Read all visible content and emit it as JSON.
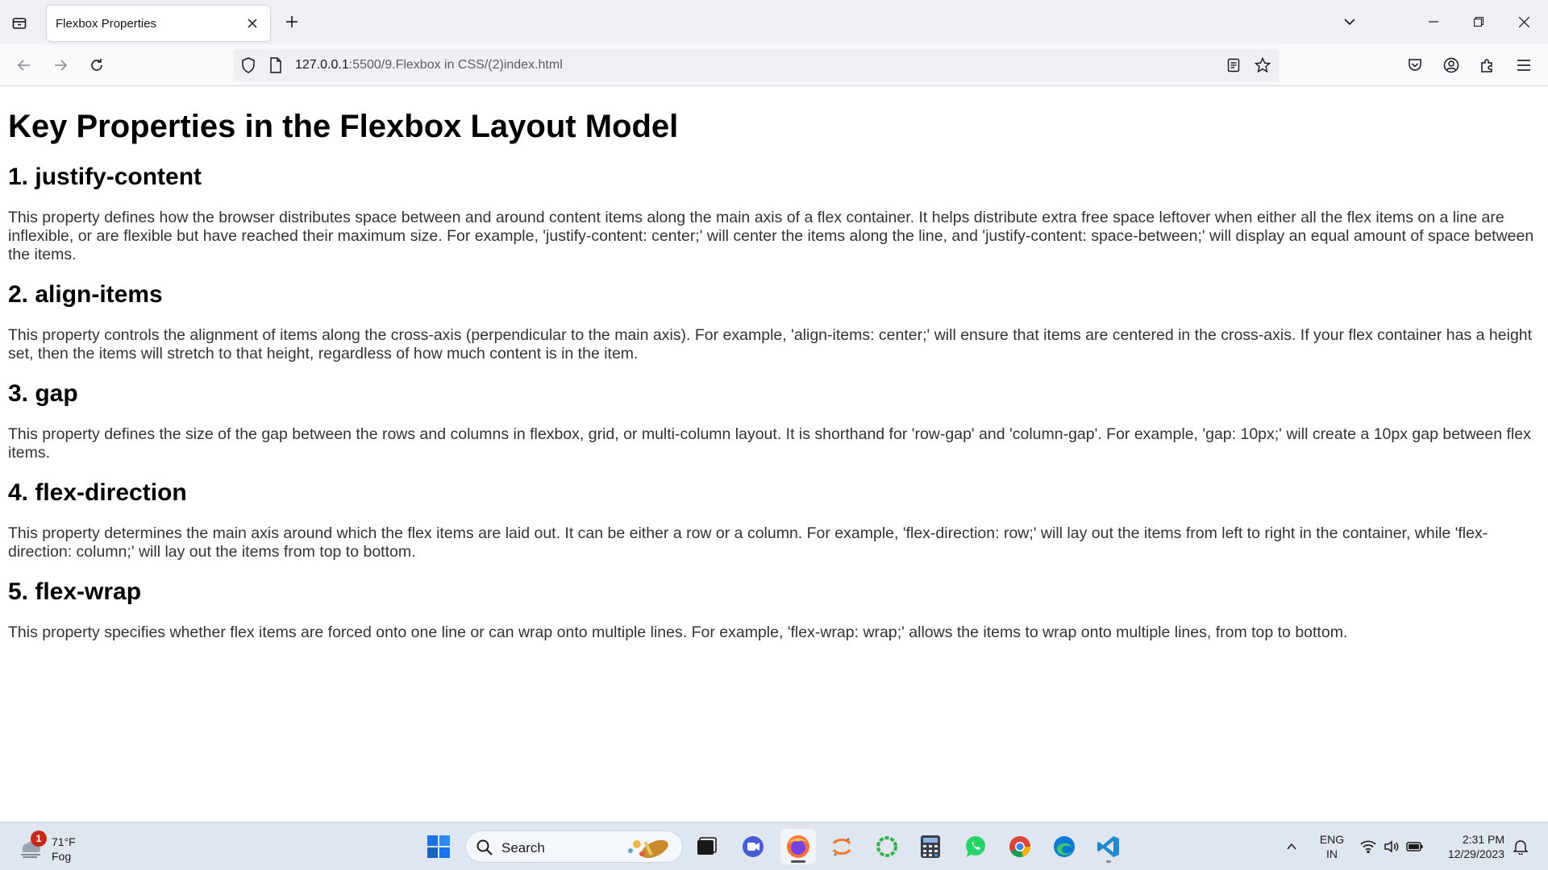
{
  "browser": {
    "tab_title": "Flexbox Properties",
    "url_host": "127.0.0.1",
    "url_rest": ":5500/9.Flexbox in CSS/(2)index.html"
  },
  "page": {
    "heading": "Key Properties in the Flexbox Layout Model",
    "sections": [
      {
        "title": "1. justify-content",
        "body": "This property defines how the browser distributes space between and around content items along the main axis of a flex container. It helps distribute extra free space leftover when either all the flex items on a line are inflexible, or are flexible but have reached their maximum size. For example, 'justify-content: center;' will center the items along the line, and 'justify-content: space-between;' will display an equal amount of space between the items."
      },
      {
        "title": "2. align-items",
        "body": "This property controls the alignment of items along the cross-axis (perpendicular to the main axis). For example, 'align-items: center;' will ensure that items are centered in the cross-axis. If your flex container has a height set, then the items will stretch to that height, regardless of how much content is in the item."
      },
      {
        "title": "3. gap",
        "body": "This property defines the size of the gap between the rows and columns in flexbox, grid, or multi-column layout. It is shorthand for 'row-gap' and 'column-gap'. For example, 'gap: 10px;' will create a 10px gap between flex items."
      },
      {
        "title": "4. flex-direction",
        "body": "This property determines the main axis around which the flex items are laid out. It can be either a row or a column. For example, 'flex-direction: row;' will lay out the items from left to right in the container, while 'flex-direction: column;' will lay out the items from top to bottom."
      },
      {
        "title": "5. flex-wrap",
        "body": "This property specifies whether flex items are forced onto one line or can wrap onto multiple lines. For example, 'flex-wrap: wrap;' allows the items to wrap onto multiple lines, from top to bottom."
      }
    ]
  },
  "taskbar": {
    "weather_badge": "1",
    "weather_temp": "71°F",
    "weather_cond": "Fog",
    "search_label": "Search",
    "lang_line1": "ENG",
    "lang_line2": "IN",
    "time": "2:31 PM",
    "date": "12/29/2023",
    "apps": [
      "windows-start",
      "file-explorer",
      "zoom",
      "firefox",
      "jupyter",
      "app-green",
      "calculator",
      "whatsapp",
      "chrome",
      "edge",
      "vscode"
    ]
  },
  "colors": {
    "text": "#000000",
    "body_text": "#333333",
    "chrome_bg": "#f0f0f4",
    "taskbar_bg": "#dfe6ef"
  }
}
